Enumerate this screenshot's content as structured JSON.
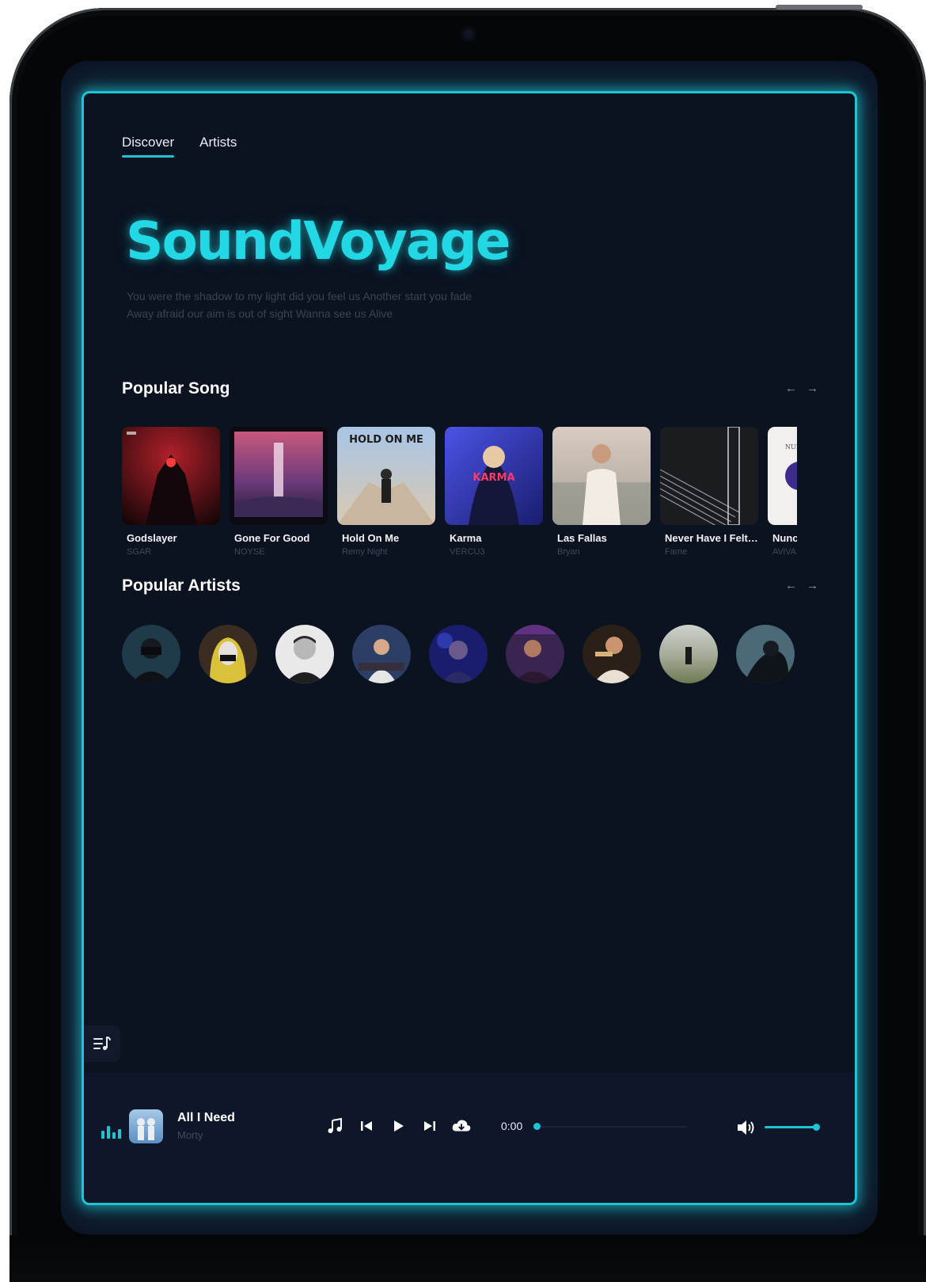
{
  "nav": {
    "tabs": [
      "Discover",
      "Artists"
    ],
    "active": "Discover"
  },
  "hero": {
    "brand": "SoundVoyage",
    "tagline_line1": "You were the shadow to my light did you feel us Another start you fade",
    "tagline_line2": "Away afraid our aim is out of sight Wanna see us Alive"
  },
  "popular_songs": {
    "title": "Popular Song",
    "items": [
      {
        "title": "Godslayer",
        "artist": "SGAR"
      },
      {
        "title": "Gone For Good",
        "artist": "NOYSE"
      },
      {
        "title": "Hold On Me",
        "artist": "Remy Night",
        "cover_text": "HOLD ON ME"
      },
      {
        "title": "Karma",
        "artist": "VERCU3",
        "cover_text": "KARMA"
      },
      {
        "title": "Las Fallas",
        "artist": "Bryan"
      },
      {
        "title": "Never Have I Felt This",
        "artist": "Fame"
      },
      {
        "title": "Nunca",
        "artist": "AViVA",
        "cover_text": "NUNCA"
      }
    ]
  },
  "popular_artists": {
    "title": "Popular Artists",
    "count": 9
  },
  "player": {
    "title": "All I Need",
    "artist": "Morty",
    "time": "0:00",
    "progress": 0.0,
    "volume": 1.0
  },
  "colors": {
    "accent": "#1fc4d2",
    "background": "#0b1220",
    "player_bg": "#0e1729"
  },
  "icons": [
    "arrow-left-icon",
    "arrow-right-icon",
    "queue-icon",
    "equalizer-icon",
    "music-note-icon",
    "previous-icon",
    "play-icon",
    "next-icon",
    "cloud-download-icon",
    "volume-icon"
  ]
}
